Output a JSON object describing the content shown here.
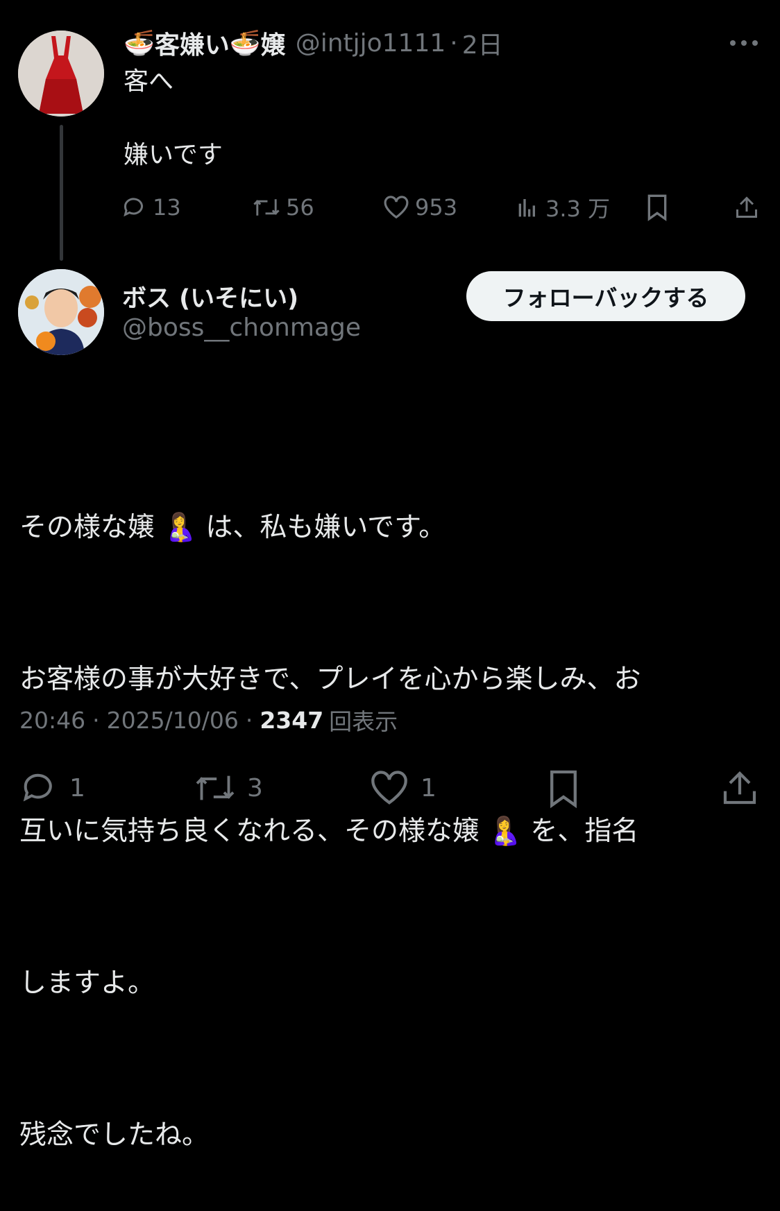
{
  "original_tweet": {
    "display_name_before": "🍜",
    "display_name_middle": "客嫌い",
    "display_name_icon": "🍜",
    "display_name_after": "嬢",
    "handle": "@intjjo1111",
    "separator": "·",
    "time_ago": "2日",
    "text_line1": "客へ",
    "text_line2": "嫌いです",
    "replies": "13",
    "retweets": "56",
    "likes": "953",
    "views": "3.3 万"
  },
  "reply_tweet": {
    "display_name": "ボス (いそにい)",
    "handle": "@boss__chonmage",
    "follow_label": "フォローバックする",
    "line1": "その様な嬢 🤱 は、私も嫌いです。",
    "line2": "お客様の事が大好きで、プレイを心から楽しみ、お",
    "line3": "互いに気持ち良くなれる、その様な嬢 🤱 を、指名",
    "line4": "しますよ。",
    "line5": "残念でしたね。",
    "time": "20:46",
    "date": "2025/10/06",
    "dot": "·",
    "views_count": "2347",
    "views_label": "回表示",
    "replies": "1",
    "retweets": "3",
    "likes": "1"
  }
}
